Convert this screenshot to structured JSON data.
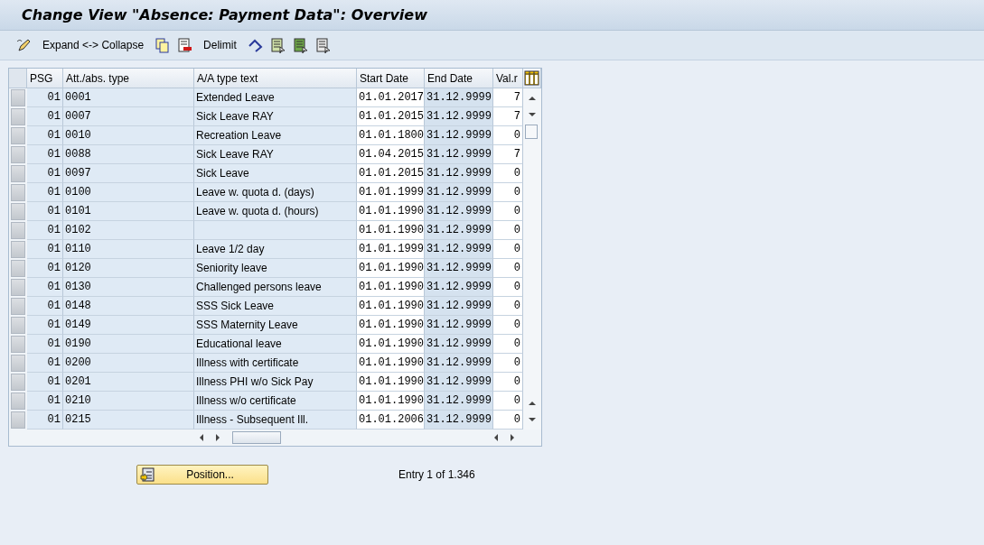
{
  "window": {
    "title": "Change View \"Absence: Payment Data\": Overview"
  },
  "toolbar": {
    "expand_label": "Expand <-> Collapse",
    "delimit_label": "Delimit"
  },
  "table": {
    "columns": [
      "PSG",
      "Att./abs. type",
      "A/A type text",
      "Start Date",
      "End Date",
      "Val.r"
    ],
    "rows": [
      {
        "psg": "01",
        "type": "0001",
        "text": "Extended Leave",
        "start": "01.01.2017",
        "end": "31.12.9999",
        "val": "7"
      },
      {
        "psg": "01",
        "type": "0007",
        "text": "Sick Leave RAY",
        "start": "01.01.2015",
        "end": "31.12.9999",
        "val": "7"
      },
      {
        "psg": "01",
        "type": "0010",
        "text": "Recreation Leave",
        "start": "01.01.1800",
        "end": "31.12.9999",
        "val": "0"
      },
      {
        "psg": "01",
        "type": "0088",
        "text": "Sick Leave RAY",
        "start": "01.04.2015",
        "end": "31.12.9999",
        "val": "7"
      },
      {
        "psg": "01",
        "type": "0097",
        "text": "Sick Leave",
        "start": "01.01.2015",
        "end": "31.12.9999",
        "val": "0"
      },
      {
        "psg": "01",
        "type": "0100",
        "text": "Leave w. quota d. (days)",
        "start": "01.01.1999",
        "end": "31.12.9999",
        "val": "0"
      },
      {
        "psg": "01",
        "type": "0101",
        "text": "Leave w. quota d. (hours)",
        "start": "01.01.1990",
        "end": "31.12.9999",
        "val": "0"
      },
      {
        "psg": "01",
        "type": "0102",
        "start": "01.01.1990",
        "end": "31.12.9999",
        "val": "0"
      },
      {
        "psg": "01",
        "type": "0110",
        "text": "Leave 1/2 day",
        "start": "01.01.1999",
        "end": "31.12.9999",
        "val": "0"
      },
      {
        "psg": "01",
        "type": "0120",
        "text": "Seniority leave",
        "start": "01.01.1990",
        "end": "31.12.9999",
        "val": "0"
      },
      {
        "psg": "01",
        "type": "0130",
        "text": "Challenged persons leave",
        "start": "01.01.1990",
        "end": "31.12.9999",
        "val": "0"
      },
      {
        "psg": "01",
        "type": "0148",
        "text": "SSS Sick Leave",
        "start": "01.01.1990",
        "end": "31.12.9999",
        "val": "0"
      },
      {
        "psg": "01",
        "type": "0149",
        "text": "SSS Maternity Leave",
        "start": "01.01.1990",
        "end": "31.12.9999",
        "val": "0"
      },
      {
        "psg": "01",
        "type": "0190",
        "text": "Educational leave",
        "start": "01.01.1990",
        "end": "31.12.9999",
        "val": "0"
      },
      {
        "psg": "01",
        "type": "0200",
        "text": "Illness with certificate",
        "start": "01.01.1990",
        "end": "31.12.9999",
        "val": "0"
      },
      {
        "psg": "01",
        "type": "0201",
        "text": "Illness PHI w/o Sick Pay",
        "start": "01.01.1990",
        "end": "31.12.9999",
        "val": "0"
      },
      {
        "psg": "01",
        "type": "0210",
        "text": "Illness w/o certificate",
        "start": "01.01.1990",
        "end": "31.12.9999",
        "val": "0"
      },
      {
        "psg": "01",
        "type": "0215",
        "text": "Illness - Subsequent Ill.",
        "start": "01.01.2006",
        "end": "31.12.9999",
        "val": "0"
      }
    ]
  },
  "position_button": "Position...",
  "entry_info": "Entry 1 of 1.346"
}
